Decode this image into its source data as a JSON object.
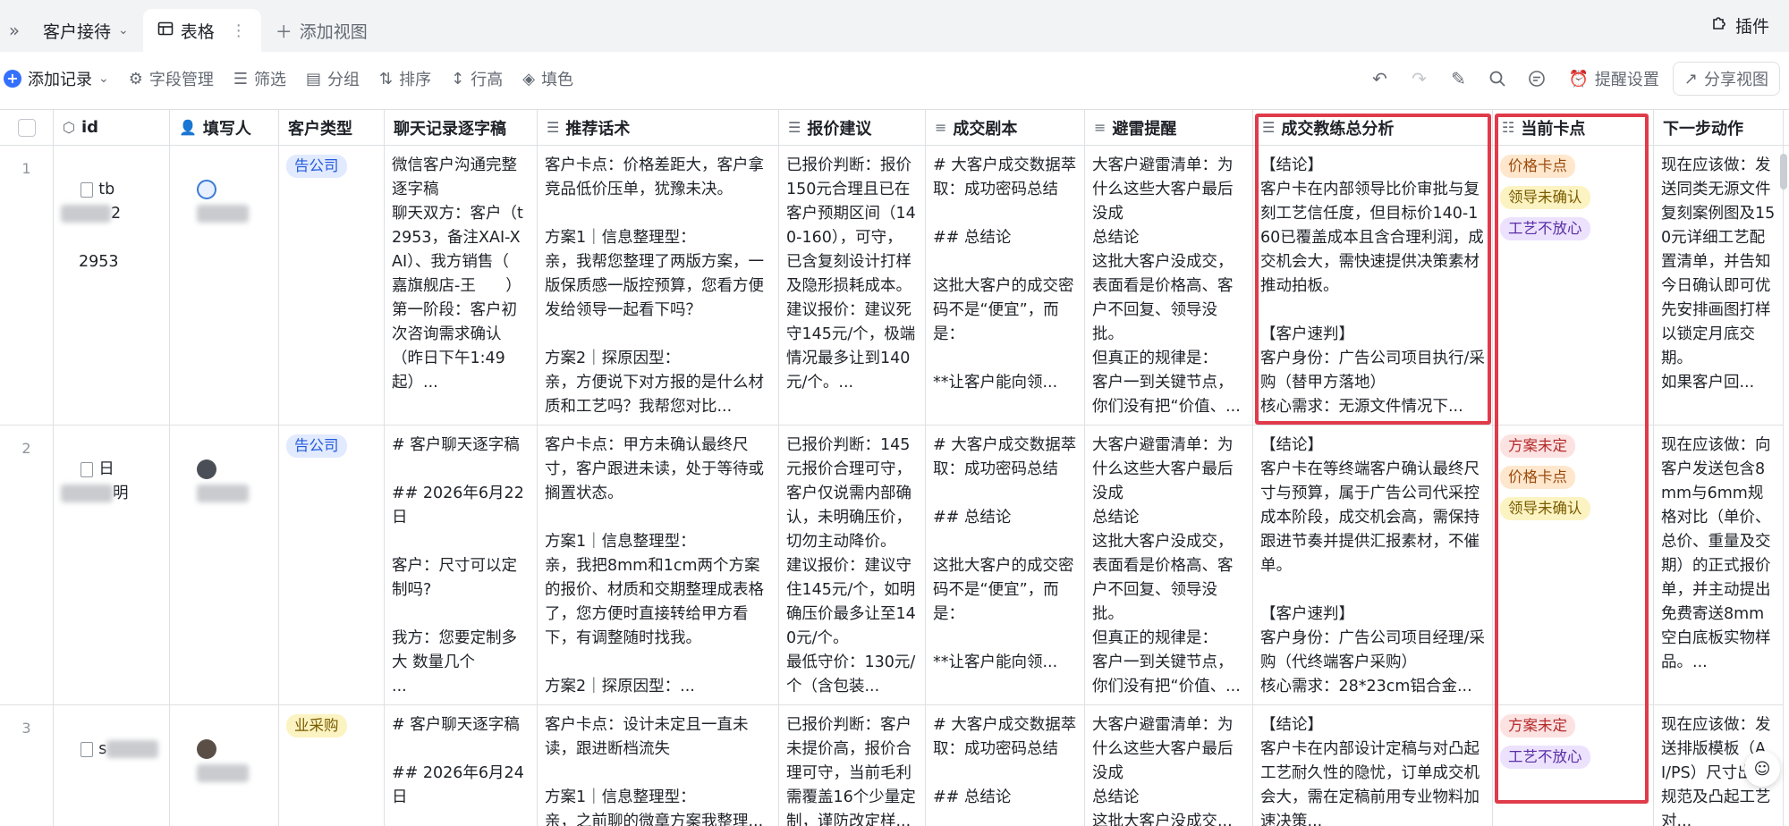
{
  "tabs": {
    "collapse_icon": "double-chevron-right-icon",
    "customer_reception": "客户接待",
    "table": "表格",
    "add_view": "添加视图",
    "plugin": "插件"
  },
  "toolbar": {
    "add_record": "添加记录",
    "field_manage": "字段管理",
    "filter": "筛选",
    "group": "分组",
    "sort": "排序",
    "row_height": "行高",
    "fill_color": "填色",
    "reminder": "提醒设置",
    "share_view": "分享视图"
  },
  "headers": {
    "id": "id",
    "filler": "填写人",
    "customer_type": "客户类型",
    "chat_transcript": "聊天记录逐字稿",
    "recommended_script": "推荐话术",
    "quote_advice": "报价建议",
    "deal_script": "成交剧本",
    "pitfall_reminder": "避雷提醒",
    "deal_coach_summary": "成交教练总分析",
    "current_blocker": "当前卡点",
    "next_action": "下一步动作"
  },
  "rows": [
    {
      "index": "1",
      "id_prefix": "tb",
      "id_suffix": "2",
      "id_line2": "2953",
      "customer_type": "告公司",
      "chat": "微信客户沟通完整逐字稿\n聊天双方：客户（t        2953，备注XAI-XAI）、我方销售（      嘉旗舰店-王      ）\n第一阶段：客户初次咨询需求确认（昨日下午1:49起）...",
      "script": "客户卡点：价格差距大，客户拿竞品低价压单，犹豫未决。\n\n方案1｜信息整理型：\n亲，我帮您整理了两版方案，一版保质感一版控预算，您看方便发给领导一起看下吗？\n\n方案2｜探原因型：\n亲，方便说下对方报的是什么材质和工艺吗？我帮您对比...",
      "quote": "已报价判断：报价150元合理且已在客户预期区间（140-160），可守，已含复刻设计打样及隐形损耗成本。\n建议报价：建议死守145元/个，极端情况最多让到140元/个。...",
      "deal": "# 大客户成交数据萃取：成功密码总结\n\n## 总结论\n\n这批大客户的成交密码不是“便宜”，而是：\n\n**让客户能向领...",
      "pitfall": "大客户避雷清单：为什么这些大客户最后没成\n总结论\n这批大客户没成交，表面看是价格高、客户不回复、领导没批。\n但真正的规律是：\n客户一到关键节点，你们没有把“价值、...",
      "summary": "【结论】\n客户卡在内部领导比价审批与复刻工艺信任度，但目标价140-160已覆盖成本且含合理利润，成交机会大，需快速提供决策素材推动拍板。\n\n【客户速判】\n客户身份：广告公司项目执行/采购（替甲方落地）\n核心需求：无源文件情况下...",
      "blockers": [
        "价格卡点",
        "领导未确认",
        "工艺不放心"
      ],
      "next": "现在应该做：发送同类无源文件复刻案例图及150元详细工艺配置清单，并告知今日确认即可优先安排画图打样以锁定月底交期。\n如果客户回..."
    },
    {
      "index": "2",
      "id_prefix": "日",
      "id_suffix": "明",
      "id_line2": "",
      "customer_type": "告公司",
      "chat": "# 客户聊天逐字稿\n\n## 2026年6月22日\n\n客户：尺寸可以定制吗?\n\n我方：您要定制多大 数量几个\n...",
      "script": "客户卡点：甲方未确认最终尺寸，客户跟进未读，处于等待或搁置状态。\n\n方案1｜信息整理型：\n亲，我把8mm和1cm两个方案的报价、材质和交期整理成表格了，您方便时直接转给甲方看下，有调整随时找我。\n\n方案2｜探原因型：...",
      "quote": "已报价判断：145元报价合理可守，客户仅说需内部确认，未明确压价，切勿主动降价。\n建议报价：建议守住145元/个，如明确压价最多让至140元/个。\n最低守价：130元/个（含包装...",
      "deal": "# 大客户成交数据萃取：成功密码总结\n\n## 总结论\n\n这批大客户的成交密码不是“便宜”，而是：\n\n**让客户能向领...",
      "pitfall": "大客户避雷清单：为什么这些大客户最后没成\n总结论\n这批大客户没成交，表面看是价格高、客户不回复、领导没批。\n但真正的规律是：\n客户一到关键节点，你们没有把“价值、...",
      "summary": "【结论】\n客户卡在等终端客户确认最终尺寸与预算，属于广告公司代采控成本阶段，成交机会高，需保持跟进节奏并提供汇报素材，不催单。\n\n【客户速判】\n客户身份：广告公司项目经理/采购（代终端客户采购）\n核心需求：28*23cm铝合金...",
      "blockers": [
        "方案未定",
        "价格卡点",
        "领导未确认"
      ],
      "next": "现在应该做：向客户发送包含8mm与6mm规格对比（单价、总价、重量及交期）的正式报价单，并主动提出免费寄送8mm空白底板实物样品。..."
    },
    {
      "index": "3",
      "id_prefix": "s",
      "id_suffix": "",
      "id_line2": "",
      "customer_type": "业采购",
      "chat": "# 客户聊天逐字稿\n\n## 2026年6月24日\n\n",
      "script": "客户卡点：设计未定且一直未读，跟进断档流失\n\n方案1｜信息整理型：\n亲，之前聊的微章方案我整理...",
      "quote": "已报价判断：客户未提价高，报价合理可守，当前毛利需覆盖16个少量定制，谨防改定样...",
      "deal": "# 大客户成交数据萃取：成功密码总结\n\n## 总结论\n\n...",
      "pitfall": "大客户避雷清单：为什么这些大客户最后没成\n总结论\n这批大客户没成交...",
      "summary": "【结论】\n客户卡在内部设计定稿与对凸起工艺耐久性的隐忧，订单成交机会大，需在定稿前用专业物料加速决策...",
      "blockers": [
        "方案未定",
        "工艺不放心"
      ],
      "next": "现在应该做：发送排版模板（AI/PS）尺寸出血规范及凸起工艺对..."
    }
  ],
  "colors": {
    "highlight": "#e03b4a",
    "accent": "#3370ff"
  }
}
